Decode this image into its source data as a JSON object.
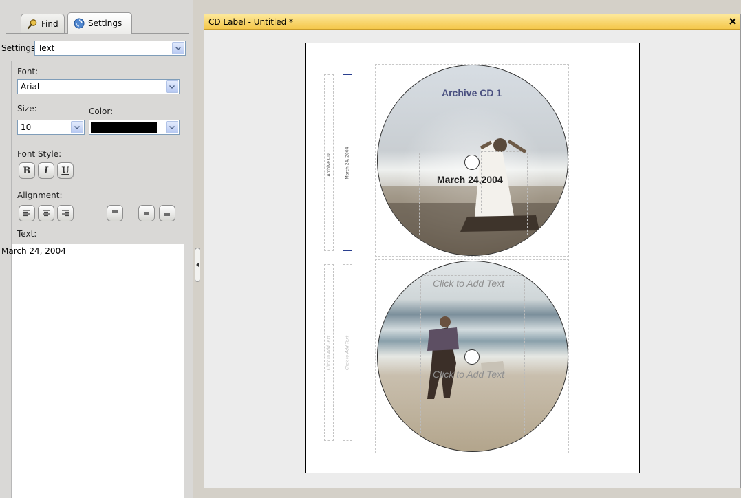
{
  "tabs": {
    "find_label": "Find",
    "settings_label": "Settings"
  },
  "settings": {
    "label": "Settings:",
    "selected": "Text"
  },
  "font": {
    "label": "Font:",
    "selected": "Arial"
  },
  "size": {
    "label": "Size:",
    "selected": "10"
  },
  "color": {
    "label": "Color:",
    "value": "#000000"
  },
  "font_style": {
    "label": "Font Style:",
    "bold": "B",
    "italic": "I",
    "underline": "U"
  },
  "alignment": {
    "label": "Alignment:"
  },
  "text": {
    "label": "Text:",
    "value": "March 24, 2004"
  },
  "document": {
    "title": "CD Label - Untitled *"
  },
  "label_top": {
    "spine_1": "Archive CD 1",
    "spine_2": "March 24, 2004",
    "title": "Archive CD 1",
    "date": "March 24,2004"
  },
  "label_bottom": {
    "spine_1": "Click to Add Text",
    "spine_2": "Click to Add Text",
    "top_placeholder": "Click to Add Text",
    "bottom_placeholder": "Click to Add Text"
  },
  "colors": {
    "titlebar": "#f4c74a",
    "selection": "#2a3f8f",
    "title_text": "#4a5080"
  }
}
